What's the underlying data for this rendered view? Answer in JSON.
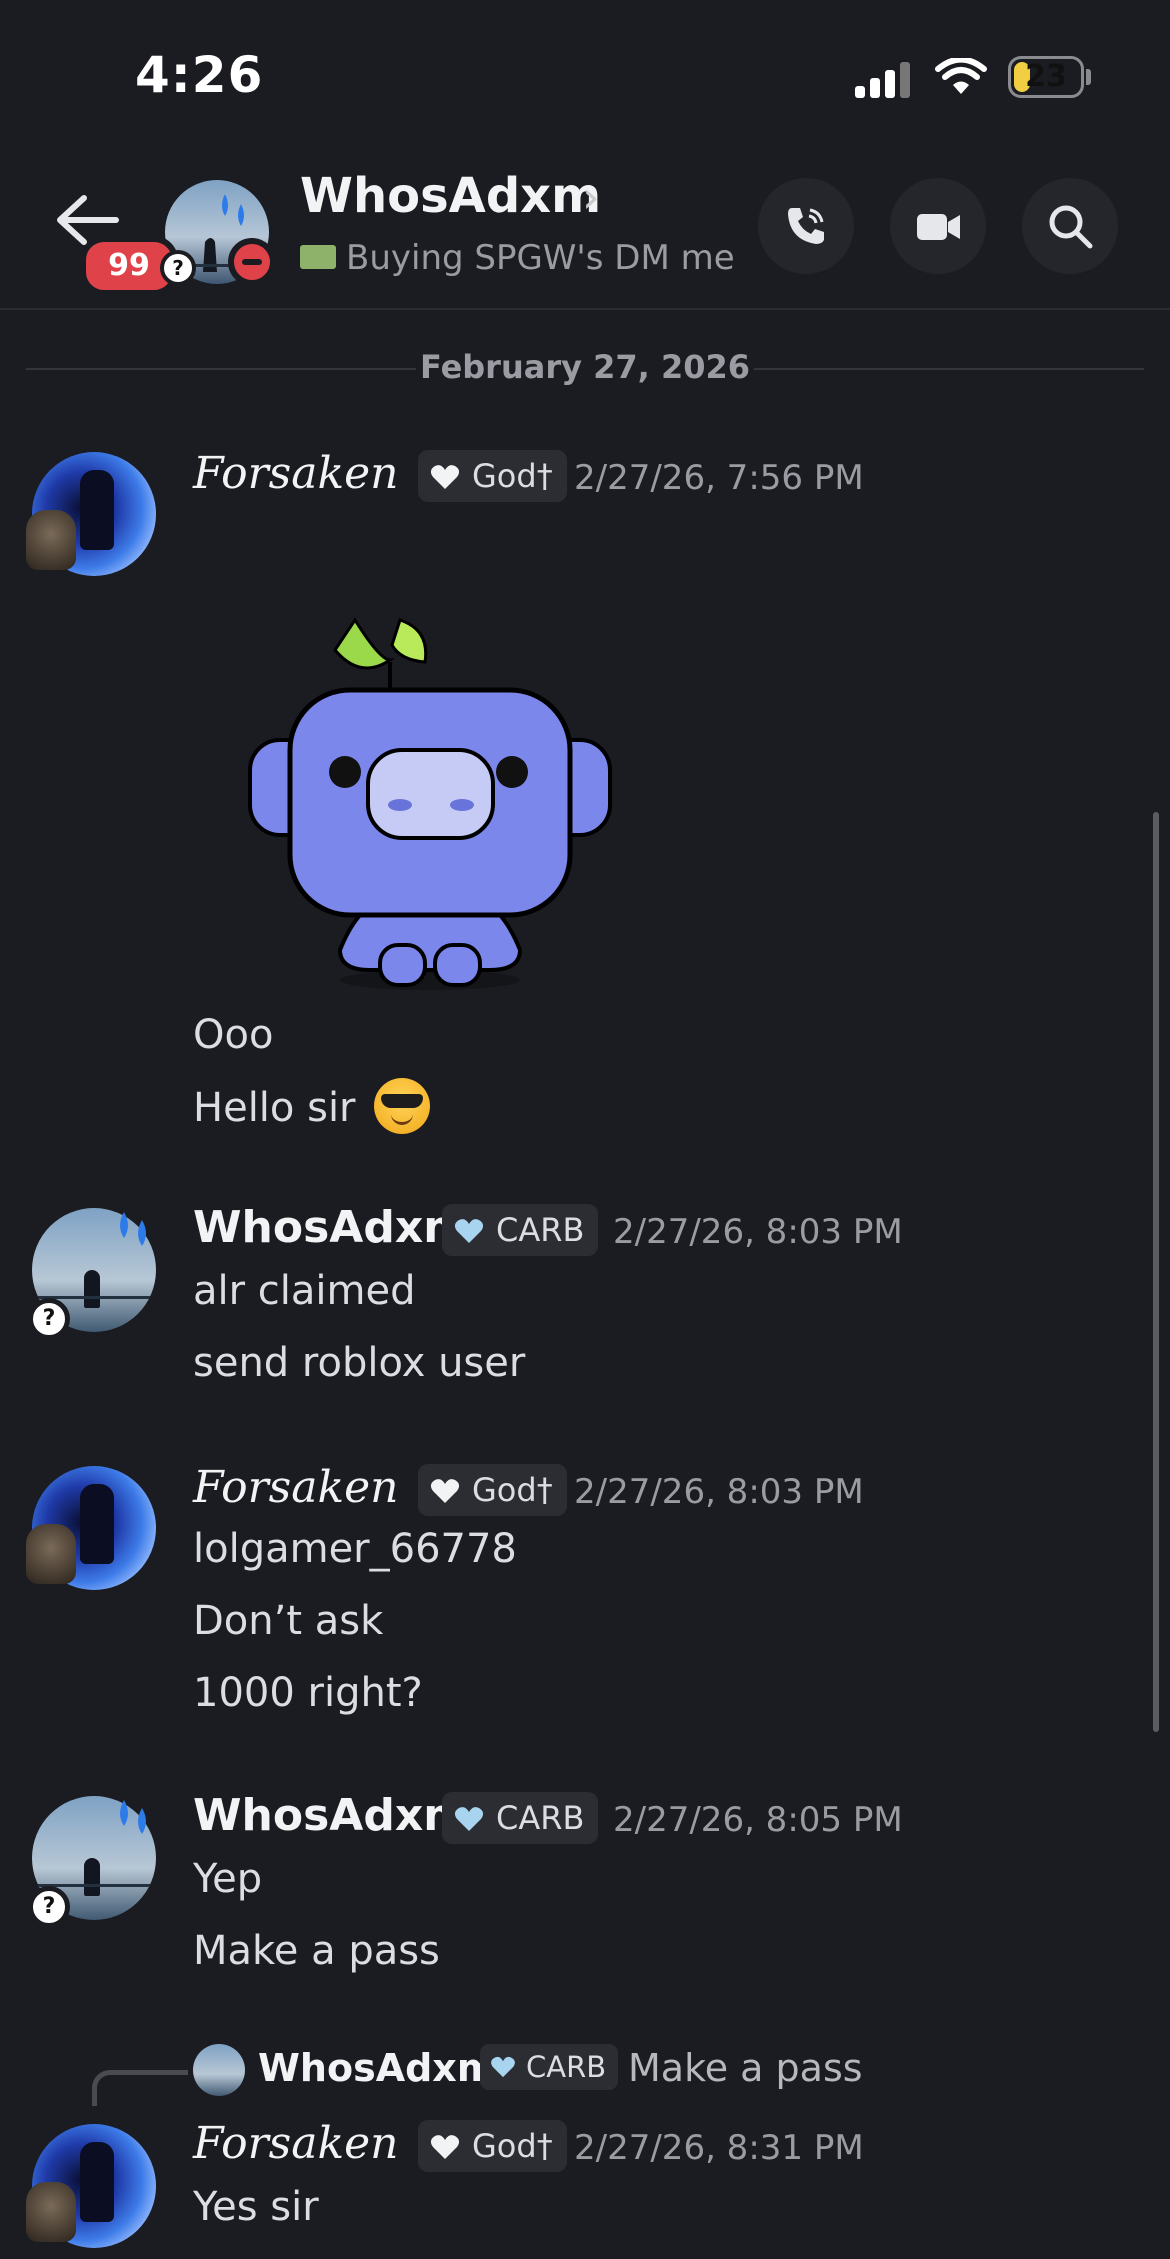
{
  "status_bar": {
    "time": "4:26",
    "battery": "23"
  },
  "header": {
    "unread_badge": "99",
    "name": "WhosAdxm",
    "chevron": "›",
    "status_text": "Buying SPGW's DM me",
    "status_icon": "money-icon",
    "actions": [
      "phone-icon",
      "video-icon",
      "search-icon"
    ]
  },
  "date_divider": "February 27, 2026",
  "messages": [
    {
      "author": "Forsaken",
      "role": "God†",
      "timestamp": "2/27/26, 7:56 PM",
      "sticker": "wumpus-sticker",
      "lines": [
        "Ooo",
        "Hello sir"
      ],
      "emoji": "😎"
    },
    {
      "author": "WhosAdxm",
      "role": "CARB",
      "timestamp": "2/27/26, 8:03 PM",
      "lines": [
        "alr claimed",
        "send roblox user"
      ]
    },
    {
      "author": "Forsaken",
      "role": "God†",
      "timestamp": "2/27/26, 8:03 PM",
      "lines": [
        "lolgamer_66778",
        "Don’t ask",
        "1000 right?"
      ]
    },
    {
      "author": "WhosAdxm",
      "role": "CARB",
      "timestamp": "2/27/26, 8:05 PM",
      "lines": [
        "Yep",
        "Make a pass"
      ]
    },
    {
      "reply_to": {
        "author": "WhosAdxm",
        "role": "CARB",
        "text": "Make a pass"
      },
      "author": "Forsaken",
      "role": "God†",
      "timestamp": "2/27/26, 8:31 PM",
      "lines": [
        "Yes sir"
      ]
    }
  ],
  "colors": {
    "background": "#1b1c21",
    "dnd_red": "#e0424a",
    "role_bg": "#2c2d33",
    "muted": "#9b9ca3"
  }
}
